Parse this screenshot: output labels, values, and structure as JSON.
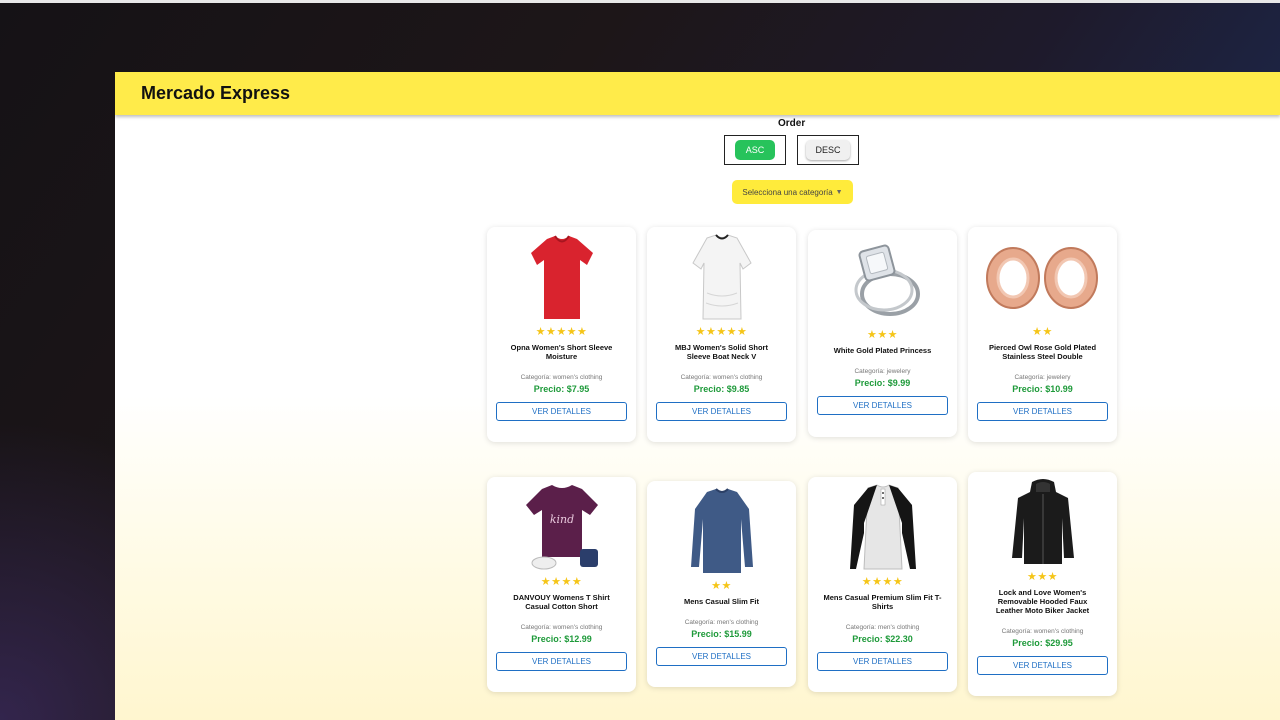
{
  "app": {
    "title": "Mercado Express"
  },
  "order": {
    "title": "Order",
    "asc_label": "ASC",
    "desc_label": "DESC"
  },
  "category_select": {
    "placeholder": "Selecciona una categoría"
  },
  "labels": {
    "category_prefix": "Categoría:",
    "price_prefix": "Precio:",
    "details_button": "VER DETALLES"
  },
  "products": [
    {
      "name": "Opna Women's Short Sleeve Moisture",
      "stars": "★★★★★",
      "category": "women's clothing",
      "price": "$7.95",
      "image": "red-tshirt-icon"
    },
    {
      "name": "MBJ Women's Solid Short Sleeve Boat Neck V",
      "stars": "★★★★★",
      "category": "women's clothing",
      "price": "$9.85",
      "image": "white-top-icon"
    },
    {
      "name": "White Gold Plated Princess",
      "stars": "★★★",
      "category": "jewelery",
      "price": "$9.99",
      "image": "diamond-ring-icon"
    },
    {
      "name": "Pierced Owl Rose Gold Plated Stainless Steel Double",
      "stars": "★★",
      "category": "jewelery",
      "price": "$10.99",
      "image": "rose-gold-plugs-icon"
    },
    {
      "name": "DANVOUY Womens T Shirt Casual Cotton Short",
      "stars": "★★★★",
      "category": "women's clothing",
      "price": "$12.99",
      "image": "purple-tshirt-icon"
    },
    {
      "name": "Mens Casual Slim Fit",
      "stars": "★★",
      "category": "men's clothing",
      "price": "$15.99",
      "image": "blue-longsleeve-icon"
    },
    {
      "name": "Mens Casual Premium Slim Fit T-Shirts",
      "stars": "★★★★",
      "category": "men's clothing",
      "price": "$22.30",
      "image": "raglan-shirt-icon"
    },
    {
      "name": "Lock and Love Women's Removable Hooded Faux Leather Moto Biker Jacket",
      "stars": "★★★",
      "category": "women's clothing",
      "price": "$29.95",
      "image": "leather-jacket-icon"
    }
  ],
  "colors": {
    "appbar": "#ffeb4a",
    "asc_button": "#27c35b",
    "price": "#1e9a3a",
    "stars": "#f5c518",
    "details_button": "#1f6fc4"
  }
}
